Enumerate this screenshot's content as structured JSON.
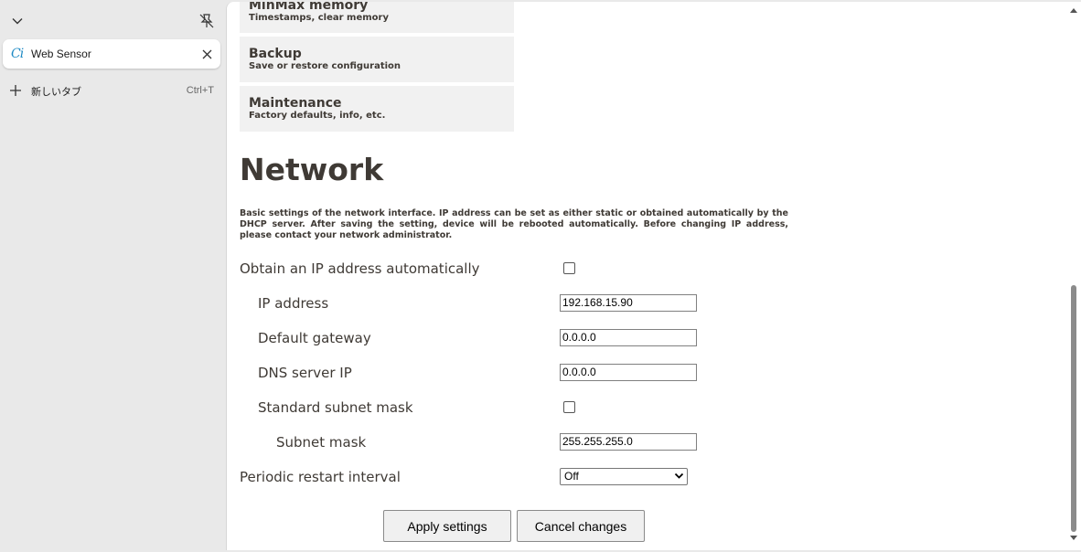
{
  "browser": {
    "tab": {
      "title": "Web Sensor",
      "favicon_text": "Ci"
    },
    "new_tab": {
      "label": "新しいタブ",
      "shortcut": "Ctrl+T"
    }
  },
  "menu": [
    {
      "title": "MinMax memory",
      "subtitle": "Timestamps, clear memory"
    },
    {
      "title": "Backup",
      "subtitle": "Save or restore configuration"
    },
    {
      "title": "Maintenance",
      "subtitle": "Factory defaults, info, etc."
    }
  ],
  "page": {
    "title": "Network",
    "description": "Basic settings of the network interface. IP address can be set as either static or obtained automatically by the DHCP server. After saving the setting, device will be rebooted automatically. Before changing IP address, please contact your network administrator."
  },
  "form": {
    "dhcp": {
      "label": "Obtain an IP address automatically",
      "checked": false
    },
    "ip": {
      "label": "IP address",
      "value": "192.168.15.90"
    },
    "gateway": {
      "label": "Default gateway",
      "value": "0.0.0.0"
    },
    "dns": {
      "label": "DNS server IP",
      "value": "0.0.0.0"
    },
    "std_mask": {
      "label": "Standard subnet mask",
      "checked": false
    },
    "mask": {
      "label": "Subnet mask",
      "value": "255.255.255.0"
    },
    "restart": {
      "label": "Periodic restart interval",
      "value": "Off"
    }
  },
  "buttons": {
    "apply": "Apply settings",
    "cancel": "Cancel changes"
  },
  "colors": {
    "text": "#3f3a35",
    "menu_bg": "#f1f1f1",
    "favicon": "#1e8ac4"
  }
}
